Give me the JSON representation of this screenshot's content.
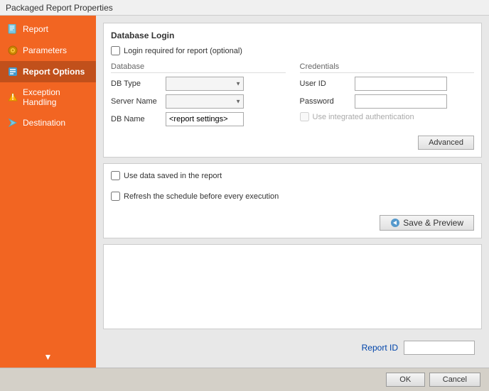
{
  "titleBar": {
    "text": "Packaged Report Properties"
  },
  "sidebar": {
    "items": [
      {
        "id": "report",
        "label": "Report",
        "icon": "📋",
        "active": false
      },
      {
        "id": "parameters",
        "label": "Parameters",
        "icon": "⚙",
        "active": false
      },
      {
        "id": "report-options",
        "label": "Report Options",
        "icon": "🔵",
        "active": true
      },
      {
        "id": "exception-handling",
        "label": "Exception Handling",
        "icon": "⚠",
        "active": false
      },
      {
        "id": "destination",
        "label": "Destination",
        "icon": "🔵",
        "active": false
      }
    ],
    "chevronDown": "▼"
  },
  "databaseLogin": {
    "title": "Database Login",
    "loginCheckbox": {
      "label": "Login required for report (optional)",
      "checked": false
    },
    "databaseSection": {
      "label": "Database",
      "dbTypeLabel": "DB Type",
      "serverNameLabel": "Server Name",
      "dbNameLabel": "DB Name",
      "dbNameValue": "<report settings>"
    },
    "credentialsSection": {
      "label": "Credentials",
      "userIdLabel": "User ID",
      "passwordLabel": "Password",
      "useIntegratedLabel": "Use integrated authentication",
      "useIntegratedChecked": false
    },
    "advancedButton": "Advanced"
  },
  "options": {
    "useDataSaved": {
      "label": "Use data saved in the report",
      "checked": false
    },
    "refreshSchedule": {
      "label": "Refresh the schedule before every execution",
      "checked": false
    },
    "savePreviewButton": "Save & Preview"
  },
  "reportIdSection": {
    "label": "Report ID",
    "value": ""
  },
  "bottomBar": {
    "okButton": "OK",
    "cancelButton": "Cancel"
  }
}
